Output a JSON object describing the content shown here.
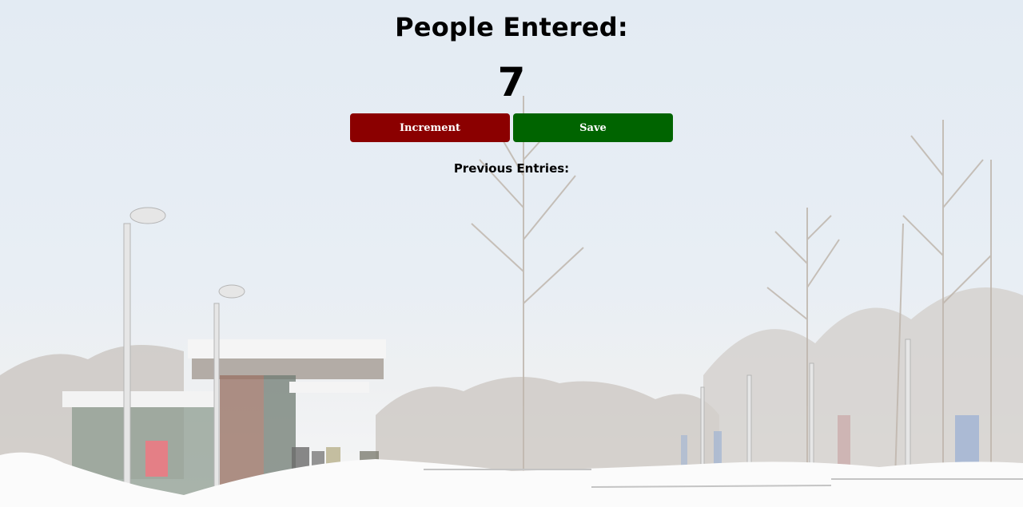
{
  "counter": {
    "title": "People Entered:",
    "count": "7"
  },
  "buttons": {
    "increment_label": "Increment",
    "save_label": "Save"
  },
  "entries": {
    "heading": "Previous Entries:",
    "items": []
  },
  "colors": {
    "increment_button": "#8b0000",
    "save_button": "#006400",
    "text": "#000000"
  }
}
